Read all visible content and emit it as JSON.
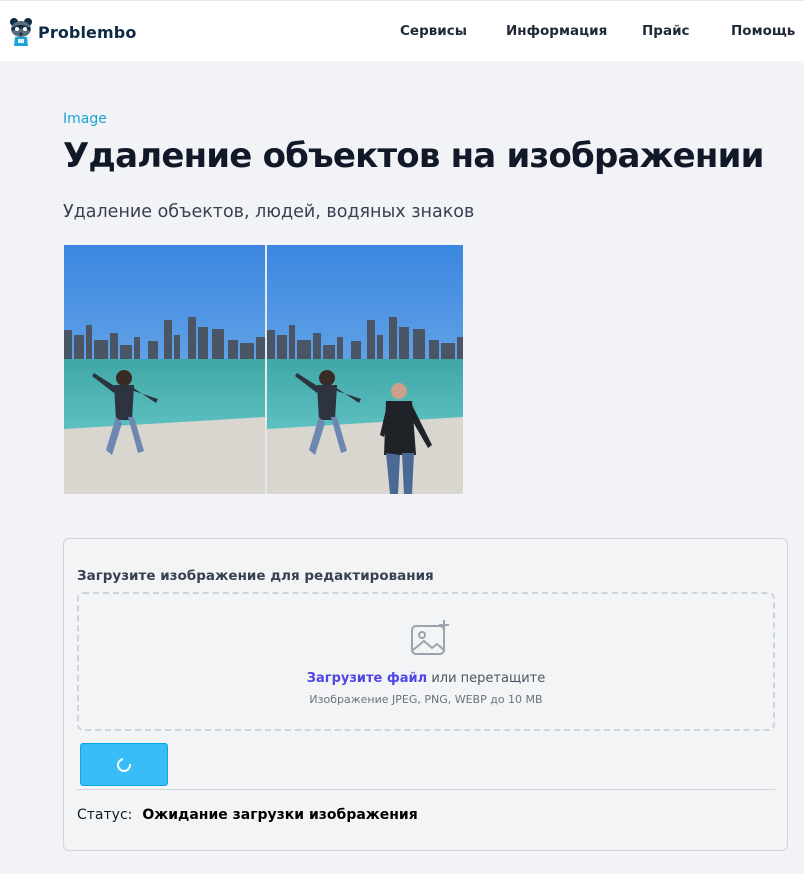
{
  "header": {
    "logo_text": "Problembo",
    "nav": [
      {
        "label": "Сервисы"
      },
      {
        "label": "Информация"
      },
      {
        "label": "Прайс"
      },
      {
        "label": "Помощь"
      }
    ]
  },
  "hero": {
    "breadcrumb": "Image",
    "title": "Удаление объектов на изображении",
    "subtitle": "Удаление объектов, людей, водяных знаков"
  },
  "upload": {
    "label": "Загрузите изображение для редактирования",
    "link_text": "Загрузите файл",
    "drag_text": " или перетащите",
    "hint": "Изображение JPEG, PNG, WEBP до 10 MB",
    "icon": "image-plus-icon"
  },
  "status": {
    "label": "Статус:",
    "value": "Ожидание загрузки изображения"
  },
  "colors": {
    "accent": "#1ba3d9",
    "button": "#38bdf8",
    "link": "#4f46e5"
  }
}
